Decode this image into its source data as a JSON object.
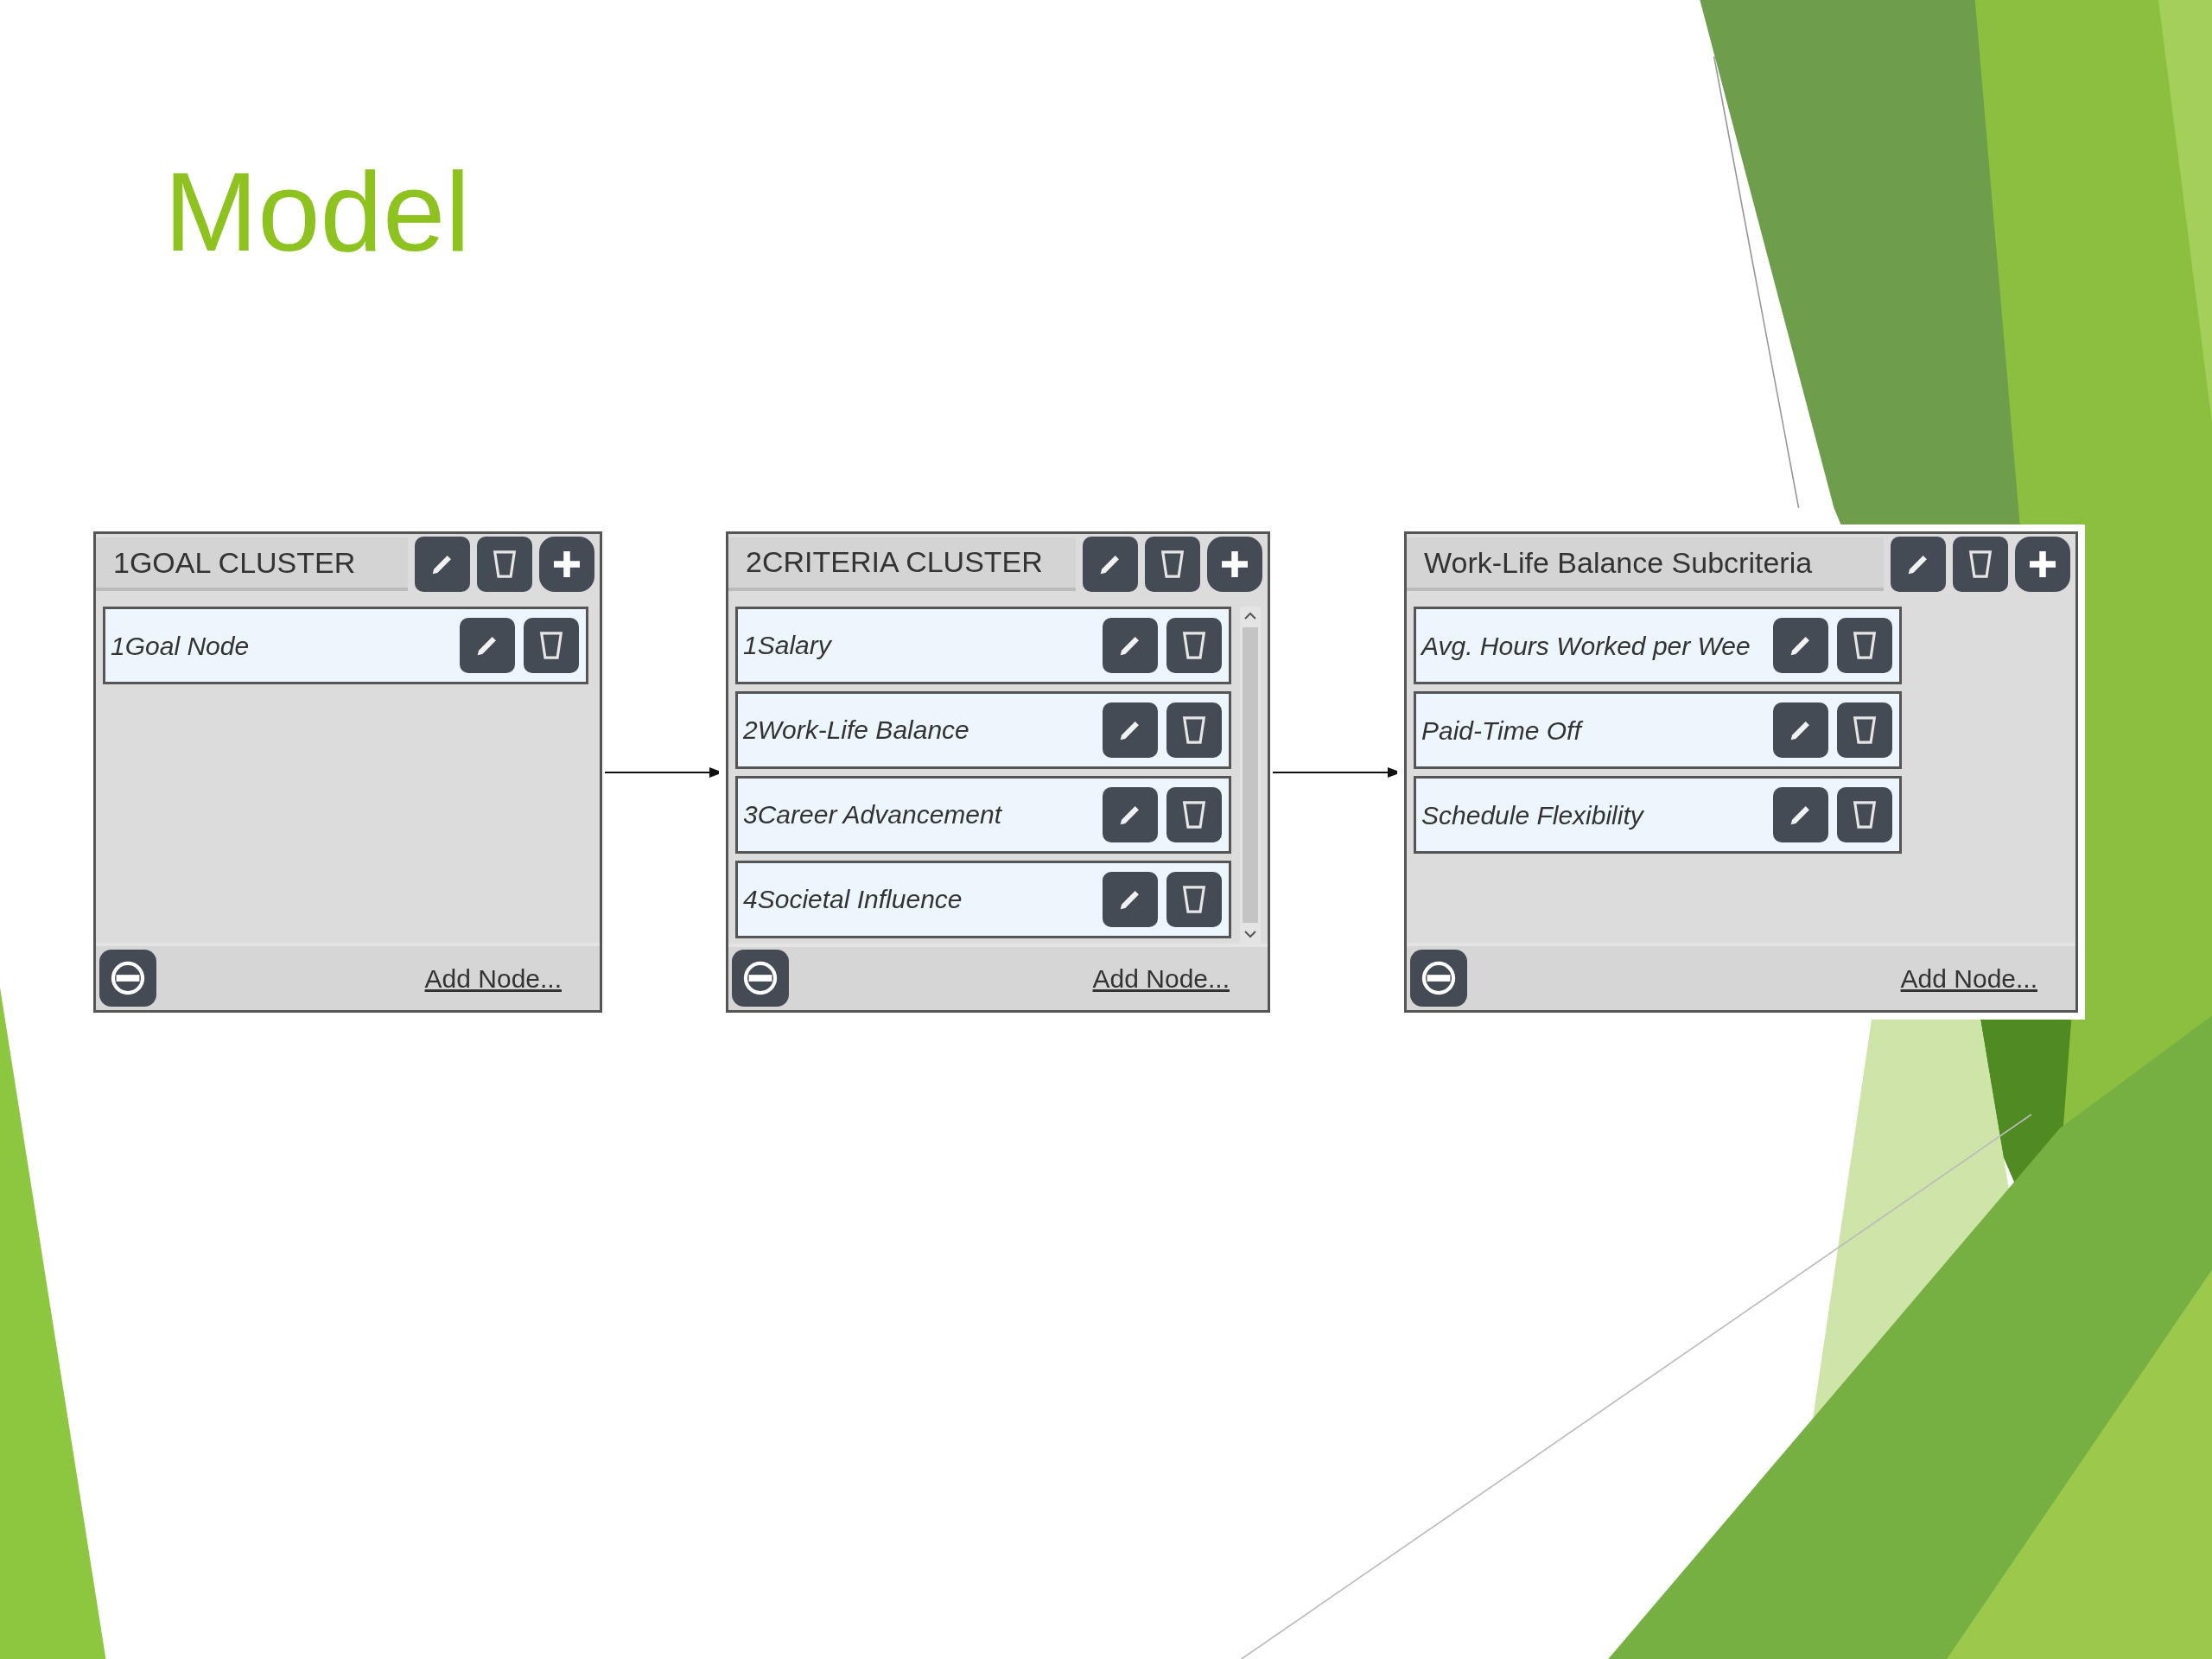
{
  "slide": {
    "title": "Model"
  },
  "clusters": [
    {
      "title": "1GOAL CLUSTER",
      "scrollbar": false,
      "add_node": "Add Node...",
      "nodes": [
        {
          "label": "1Goal Node"
        }
      ]
    },
    {
      "title": "2CRITERIA CLUSTER",
      "scrollbar": true,
      "add_node": "Add Node...",
      "nodes": [
        {
          "label": "1Salary"
        },
        {
          "label": "2Work-Life Balance"
        },
        {
          "label": "3Career Advancement"
        },
        {
          "label": "4Societal Influence"
        }
      ]
    },
    {
      "title": "Work-Life Balance Subcriteria",
      "scrollbar": false,
      "add_node": "Add Node...",
      "nodes": [
        {
          "label": "Avg. Hours Worked per Wee"
        },
        {
          "label": "Paid-Time Off"
        },
        {
          "label": "Schedule Flexibility"
        }
      ]
    }
  ]
}
